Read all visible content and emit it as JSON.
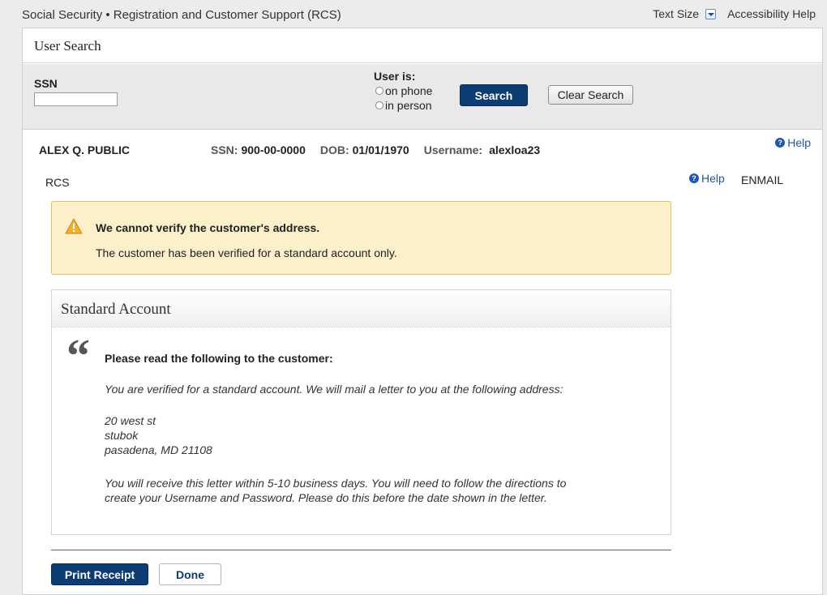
{
  "app": {
    "title": "Social Security • Registration and Customer Support (RCS)",
    "text_size_label": "Text Size",
    "accessibility_label": "Accessibility Help"
  },
  "page": {
    "title": "User Search"
  },
  "search": {
    "ssn_label": "SSN",
    "ssn_value": "",
    "user_is_label": "User is:",
    "options": [
      "on phone",
      "in person"
    ],
    "search_button": "Search",
    "clear_button": "Clear Search"
  },
  "customer": {
    "name": "ALEX Q. PUBLIC",
    "ssn_label": "SSN:",
    "ssn": "900-00-0000",
    "dob_label": "DOB:",
    "dob": "01/01/1970",
    "username_label": "Username:",
    "username": "alexloa23"
  },
  "context": {
    "help_label": "Help",
    "section_label": "RCS",
    "section_help_label": "Help",
    "code": "ENMAIL"
  },
  "alert": {
    "title": "We cannot verify the customer's address.",
    "message": "The customer has been verified for a standard account only."
  },
  "standard_account": {
    "title": "Standard Account",
    "read_heading": "Please read the following to the customer:",
    "intro": "You are verified for a standard account. We will mail a letter to you at the following address:",
    "address": [
      "20 west st",
      "stubok",
      "pasadena, MD 21108"
    ],
    "closing_line1": "You will receive this letter within 5-10 business days. You will need to follow the directions to",
    "closing_line2": "create your Username and Password. Please do this before the date shown in the letter."
  },
  "actions": {
    "print_receipt": "Print Receipt",
    "done": "Done"
  },
  "colors": {
    "primary_button": "#0c3c74",
    "alert_background": "#fbf0c9",
    "alert_border": "#e2c15c",
    "link": "#1f56a8"
  }
}
